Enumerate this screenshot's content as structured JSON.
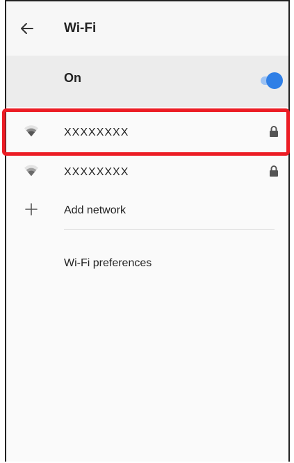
{
  "header": {
    "title": "Wi-Fi",
    "back_icon": "arrow-left-icon"
  },
  "master_switch": {
    "label": "On",
    "state": "on",
    "accent_color": "#2f7fe6"
  },
  "networks": [
    {
      "name": "XXXXXXXX",
      "signal_icon": "wifi-icon",
      "secured_icon": "lock-icon",
      "highlighted": true
    },
    {
      "name": "XXXXXXXX",
      "signal_icon": "wifi-icon",
      "secured_icon": "lock-icon",
      "highlighted": false
    }
  ],
  "add_network": {
    "label": "Add network",
    "icon": "plus-icon"
  },
  "preferences": {
    "label": "Wi-Fi preferences"
  },
  "highlight_color": "#ec1c24"
}
